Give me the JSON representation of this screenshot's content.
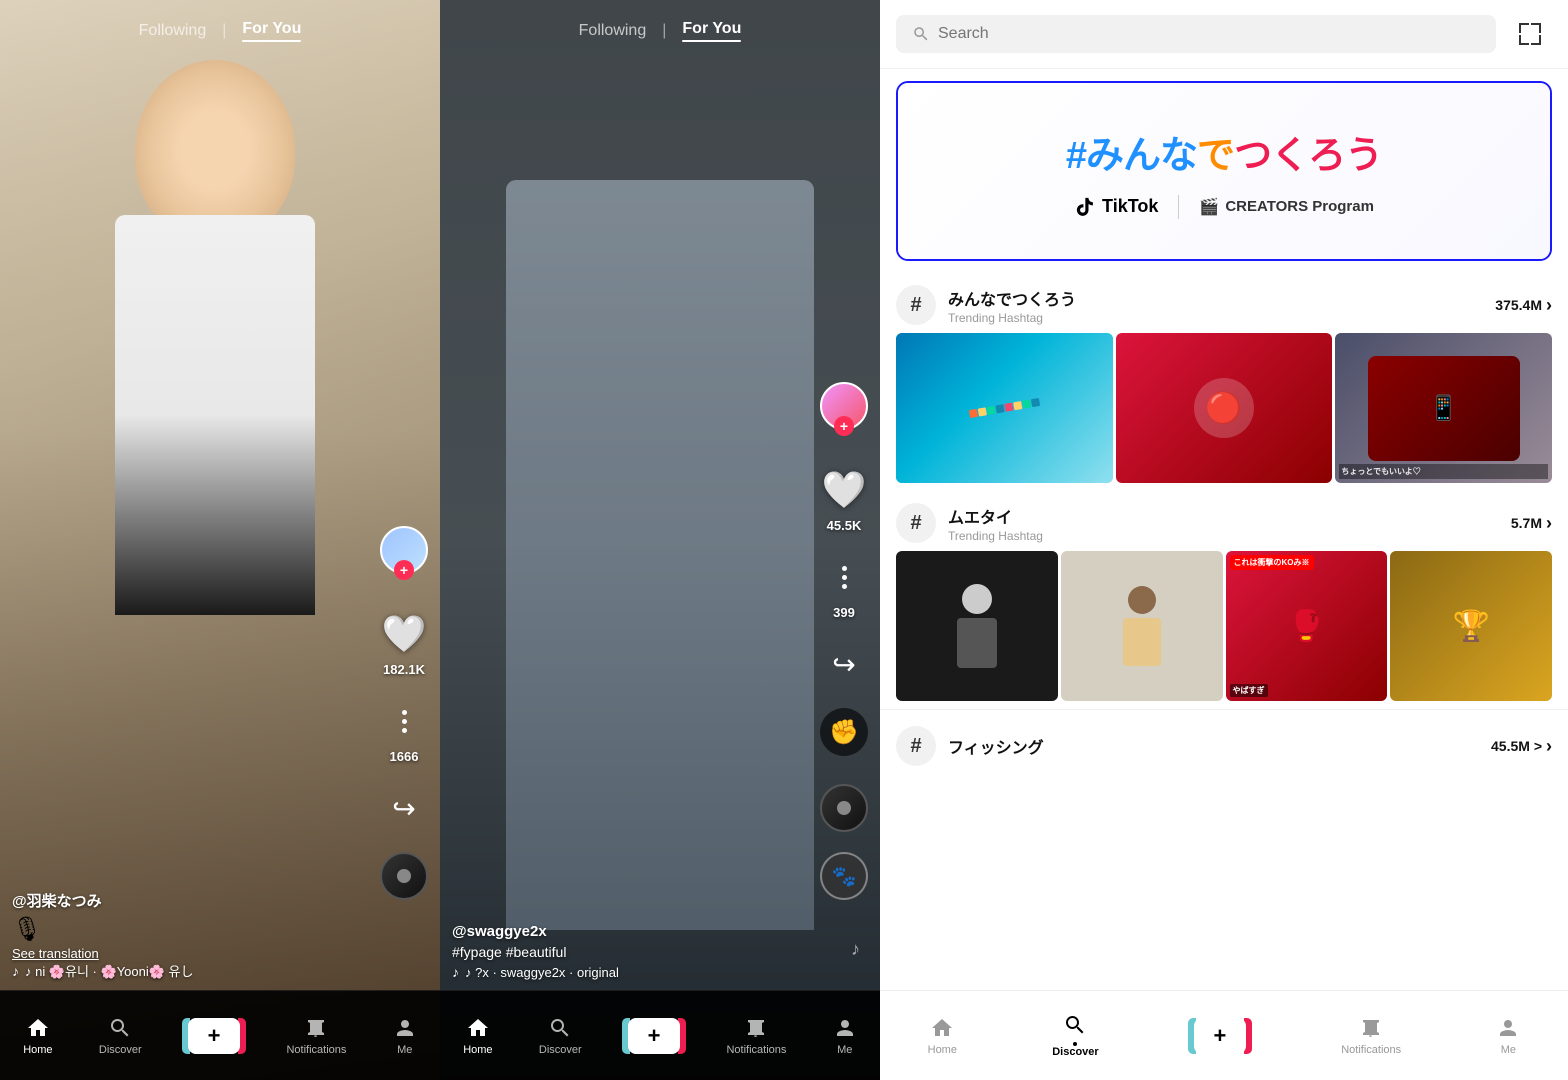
{
  "app": {
    "name": "TikTok"
  },
  "left_feed_1": {
    "nav": {
      "following": "Following",
      "for_you": "For You",
      "active": "for_you"
    },
    "username": "@羽柴なつみ",
    "emoji": "🎙",
    "see_translation": "See translation",
    "music": "♪ ni 🌸유니 · 🌸Yooni🌸 유し",
    "music_note": "♪",
    "like_count": "182.1K",
    "comment_count": "1666",
    "actions": {
      "like": "182.1K",
      "comments": "1666"
    }
  },
  "left_feed_2": {
    "nav": {
      "following": "Following",
      "for_you": "For You",
      "active": "for_you"
    },
    "username": "@swaggye2x",
    "tags": "#fypage #beautiful",
    "music": "♪ ?x · swaggye2x · original",
    "like_count": "45.5K",
    "comment_count": "399"
  },
  "bottom_nav": {
    "items": [
      {
        "id": "home",
        "label": "Home",
        "icon": "home",
        "active": true
      },
      {
        "id": "discover",
        "label": "Discover",
        "icon": "search",
        "active": false
      },
      {
        "id": "create",
        "label": "",
        "icon": "plus",
        "active": false
      },
      {
        "id": "notifications",
        "label": "Notifications",
        "icon": "inbox",
        "active": false
      },
      {
        "id": "me",
        "label": "Me",
        "icon": "person",
        "active": false
      }
    ]
  },
  "right_panel": {
    "search": {
      "placeholder": "Search"
    },
    "banner": {
      "title": "#みんなでつくろう",
      "tiktok_label": "TikTok",
      "creators_label": "CREATORS Program"
    },
    "trending": [
      {
        "id": "minna",
        "hashtag": "#",
        "name": "みんなでつくろう",
        "type": "Trending Hashtag",
        "count": "375.4M >",
        "thumbnails": [
          {
            "label": "",
            "type": "teal-craft"
          },
          {
            "label": "",
            "type": "red-coin"
          },
          {
            "label": "ちょっとでもいいよ♡",
            "type": "phone-case"
          }
        ]
      },
      {
        "id": "muetai",
        "hashtag": "#",
        "name": "ムエタイ",
        "type": "Trending Hashtag",
        "count": "5.7M >",
        "thumbnails": [
          {
            "label": "",
            "type": "dark-martial"
          },
          {
            "label": "",
            "type": "light-martial"
          },
          {
            "label": "これは衝撃のKOみ※\nやばすぎ",
            "type": "red-ko",
            "badge": "これは衝撃のKOみ※"
          },
          {
            "label": "",
            "type": "gold-martial"
          }
        ]
      }
    ],
    "fishing": {
      "name": "フィッシング",
      "count": "45.5M >"
    },
    "bottom_nav": {
      "items": [
        {
          "id": "home",
          "label": "Home",
          "icon": "home",
          "active": false
        },
        {
          "id": "discover",
          "label": "Discover",
          "icon": "search",
          "active": true
        },
        {
          "id": "create",
          "label": "",
          "icon": "plus",
          "active": false
        },
        {
          "id": "notifications",
          "label": "Notifications",
          "icon": "inbox",
          "active": false
        },
        {
          "id": "me",
          "label": "Me",
          "icon": "person",
          "active": false
        }
      ]
    }
  }
}
